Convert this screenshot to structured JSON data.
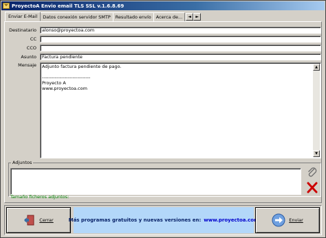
{
  "window": {
    "title": "ProyectoA Envio email TLS SSL v.1.6.8.69"
  },
  "tabs": [
    "Enviar E-Mail",
    "Datos conexión servidor SMTP",
    "Resultado envío",
    "Acerca de..."
  ],
  "form": {
    "destinatario_label": "Destinatario",
    "destinatario_value": "alonso@proyectoa.com",
    "cc_label": "CC",
    "cc_value": "",
    "cco_label": "CCO",
    "cco_value": "",
    "asunto_label": "Asunto",
    "asunto_value": "Factura pendiente",
    "mensaje_label": "Mensaje",
    "mensaje_lines": [
      "Adjunto factura pendiente de pago.",
      "",
      "------------------------------",
      "Proyecto A",
      "www.proyectoa.com"
    ]
  },
  "attachments": {
    "label": "Adjuntos",
    "size_label": "Tamaño ficheros adjuntos:",
    "add_icon": "paperclip-icon",
    "remove_icon": "red-x-icon"
  },
  "footer": {
    "close_label": "Cerrar",
    "send_label": "Enviar",
    "promo_text": "Más programas gratuitos y nuevas versiones en:",
    "promo_link": "www.proyectoa.com"
  },
  "colors": {
    "titlebar_start": "#0a246a",
    "promo_bg": "#b3d7f9",
    "size_text": "#008000",
    "remove_icon": "#cc0000"
  }
}
